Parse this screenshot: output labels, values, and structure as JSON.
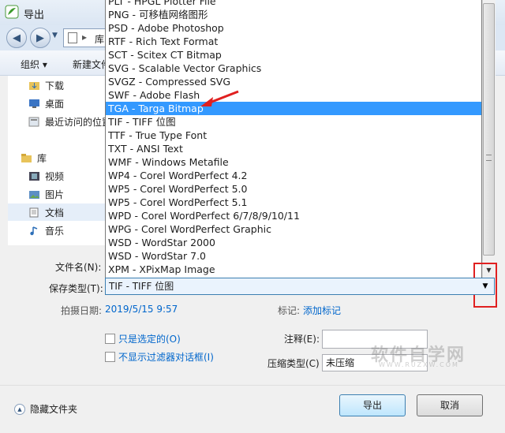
{
  "window": {
    "title": "导出"
  },
  "address": {
    "location": "库"
  },
  "toolbar": {
    "organize": "组织 ▾",
    "new_folder": "新建文件夹"
  },
  "nav": {
    "items": [
      {
        "label": "下载",
        "icon": "download-folder-icon"
      },
      {
        "label": "桌面",
        "icon": "desktop-icon"
      },
      {
        "label": "最近访问的位置",
        "icon": "recent-places-icon"
      },
      {
        "label": "库",
        "icon": "library-icon"
      },
      {
        "label": "视频",
        "icon": "video-icon"
      },
      {
        "label": "图片",
        "icon": "pictures-icon"
      },
      {
        "label": "文档",
        "icon": "documents-icon"
      },
      {
        "label": "音乐",
        "icon": "music-icon"
      }
    ]
  },
  "dropdown": {
    "options": [
      "PLT - HPGL Plotter File",
      "PNG - 可移植网络图形",
      "PSD - Adobe Photoshop",
      "RTF - Rich Text Format",
      "SCT - Scitex CT Bitmap",
      "SVG - Scalable Vector Graphics",
      "SVGZ - Compressed SVG",
      "SWF - Adobe Flash",
      "TGA - Targa Bitmap",
      "TIF - TIFF 位图",
      "TTF - True Type Font",
      "TXT - ANSI Text",
      "WMF - Windows Metafile",
      "WP4 - Corel WordPerfect 4.2",
      "WP5 - Corel WordPerfect 5.0",
      "WP5 - Corel WordPerfect 5.1",
      "WPD - Corel WordPerfect 6/7/8/9/10/11",
      "WPG - Corel WordPerfect Graphic",
      "WSD - WordStar 2000",
      "WSD - WordStar 7.0",
      "XPM - XPixMap Image"
    ],
    "selected_index": 8
  },
  "form": {
    "filename_label": "文件名(N):",
    "filetype_label": "保存类型(T):",
    "filetype_value": "TIF - TIFF 位图",
    "date_label": "拍摄日期:",
    "date_value": "2019/5/15 9:57",
    "tags_label": "标记:",
    "tags_link": "添加标记",
    "only_selected": "只是选定的(O)",
    "no_filter_dialog": "不显示过滤器对话框(I)",
    "notes_label": "注释(E):",
    "compression_label": "压缩类型(C)",
    "compression_value": "未压缩"
  },
  "watermark": {
    "text": "软件自学网",
    "sub": "WWW.RUZXW.COM"
  },
  "buttons": {
    "export": "导出",
    "cancel": "取消",
    "hide_folders": "隐藏文件夹"
  },
  "colors": {
    "selection": "#3399ff",
    "annotation_red": "#e02020",
    "link": "#0066cc"
  }
}
